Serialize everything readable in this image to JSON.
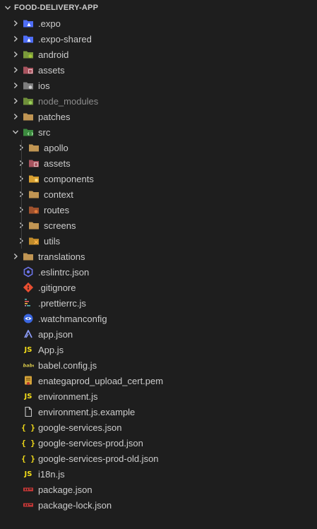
{
  "explorer": {
    "title": "FOOD-DELIVERY-APP"
  },
  "tree": [
    {
      "label": ".expo",
      "depth": 1,
      "kind": "folder",
      "open": false,
      "icon": "expo-folder-icon"
    },
    {
      "label": ".expo-shared",
      "depth": 1,
      "kind": "folder",
      "open": false,
      "icon": "expo-folder-icon"
    },
    {
      "label": "android",
      "depth": 1,
      "kind": "folder",
      "open": false,
      "icon": "android-folder-icon"
    },
    {
      "label": "assets",
      "depth": 1,
      "kind": "folder",
      "open": false,
      "icon": "assets-folder-icon"
    },
    {
      "label": "ios",
      "depth": 1,
      "kind": "folder",
      "open": false,
      "icon": "ios-folder-icon"
    },
    {
      "label": "node_modules",
      "depth": 1,
      "kind": "folder",
      "open": false,
      "icon": "node-folder-icon",
      "dim": true
    },
    {
      "label": "patches",
      "depth": 1,
      "kind": "folder",
      "open": false,
      "icon": "folder-icon"
    },
    {
      "label": "src",
      "depth": 1,
      "kind": "folder",
      "open": true,
      "icon": "src-folder-icon"
    },
    {
      "label": "apollo",
      "depth": 2,
      "kind": "folder",
      "open": false,
      "icon": "folder-icon"
    },
    {
      "label": "assets",
      "depth": 2,
      "kind": "folder",
      "open": false,
      "icon": "assets-folder-icon"
    },
    {
      "label": "components",
      "depth": 2,
      "kind": "folder",
      "open": false,
      "icon": "components-folder-icon"
    },
    {
      "label": "context",
      "depth": 2,
      "kind": "folder",
      "open": false,
      "icon": "folder-icon"
    },
    {
      "label": "routes",
      "depth": 2,
      "kind": "folder",
      "open": false,
      "icon": "routes-folder-icon"
    },
    {
      "label": "screens",
      "depth": 2,
      "kind": "folder",
      "open": false,
      "icon": "folder-icon"
    },
    {
      "label": "utils",
      "depth": 2,
      "kind": "folder",
      "open": false,
      "icon": "utils-folder-icon"
    },
    {
      "label": "translations",
      "depth": 1,
      "kind": "folder",
      "open": false,
      "icon": "folder-icon"
    },
    {
      "label": ".eslintrc.json",
      "depth": 1,
      "kind": "file",
      "icon": "eslint-icon"
    },
    {
      "label": ".gitignore",
      "depth": 1,
      "kind": "file",
      "icon": "git-icon"
    },
    {
      "label": ".prettierrc.js",
      "depth": 1,
      "kind": "file",
      "icon": "prettier-icon"
    },
    {
      "label": ".watchmanconfig",
      "depth": 1,
      "kind": "file",
      "icon": "watchman-icon"
    },
    {
      "label": "app.json",
      "depth": 1,
      "kind": "file",
      "icon": "expo-icon"
    },
    {
      "label": "App.js",
      "depth": 1,
      "kind": "file",
      "icon": "js-icon"
    },
    {
      "label": "babel.config.js",
      "depth": 1,
      "kind": "file",
      "icon": "babel-icon"
    },
    {
      "label": "enategaprod_upload_cert.pem",
      "depth": 1,
      "kind": "file",
      "icon": "certificate-icon"
    },
    {
      "label": "environment.js",
      "depth": 1,
      "kind": "file",
      "icon": "js-icon"
    },
    {
      "label": "environment.js.example",
      "depth": 1,
      "kind": "file",
      "icon": "file-icon"
    },
    {
      "label": "google-services.json",
      "depth": 1,
      "kind": "file",
      "icon": "json-icon"
    },
    {
      "label": "google-services-prod.json",
      "depth": 1,
      "kind": "file",
      "icon": "json-icon"
    },
    {
      "label": "google-services-prod-old.json",
      "depth": 1,
      "kind": "file",
      "icon": "json-icon"
    },
    {
      "label": "i18n.js",
      "depth": 1,
      "kind": "file",
      "icon": "js-icon"
    },
    {
      "label": "package.json",
      "depth": 1,
      "kind": "file",
      "icon": "npm-icon"
    },
    {
      "label": "package-lock.json",
      "depth": 1,
      "kind": "file",
      "icon": "npm-icon"
    }
  ],
  "colors": {
    "background": "#1e1e1e",
    "text": "#cccccc",
    "dim_text": "#8c8c8c",
    "folder": "#c09553",
    "js_yellow": "#f5de19",
    "npm_red": "#cb3837",
    "expo_blue": "#4f6ef7"
  }
}
